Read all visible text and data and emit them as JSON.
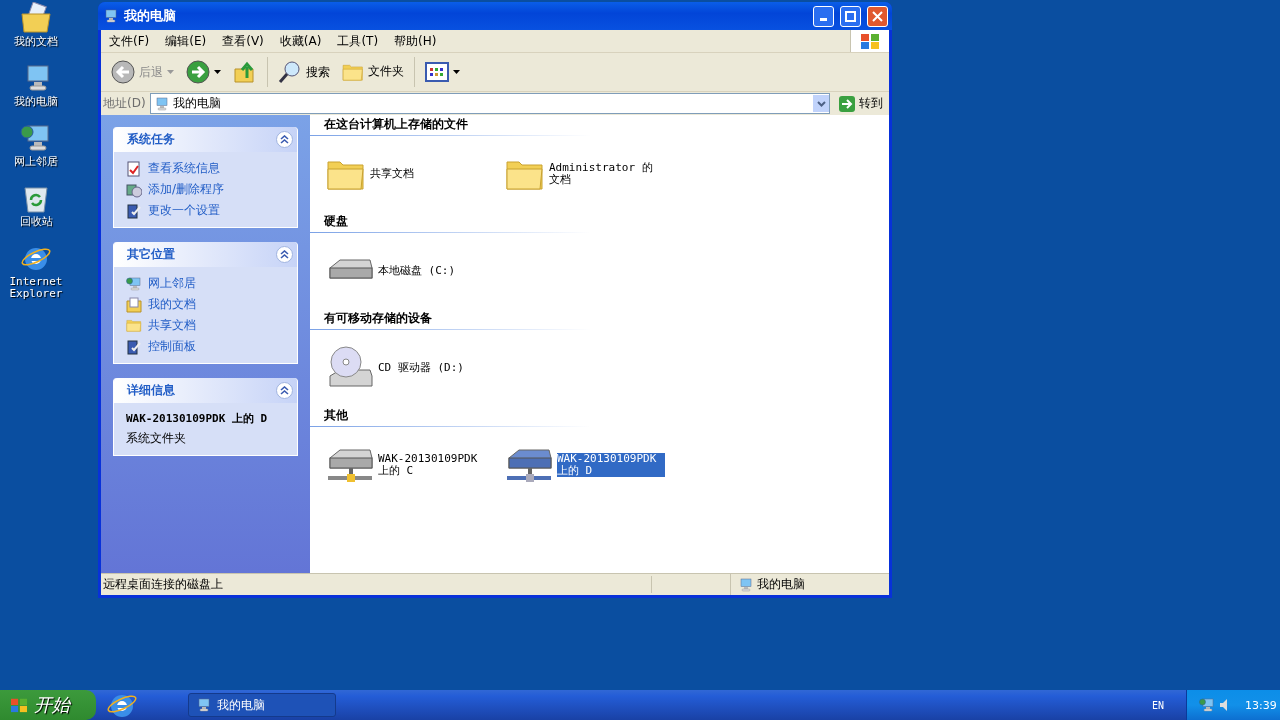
{
  "desktop": {
    "icons": [
      {
        "label": "我的文档",
        "kind": "documents"
      },
      {
        "label": "我的电脑",
        "kind": "computer"
      },
      {
        "label": "网上邻居",
        "kind": "network"
      },
      {
        "label": "回收站",
        "kind": "recycle"
      },
      {
        "label": "Internet Explorer",
        "kind": "browser"
      }
    ]
  },
  "window": {
    "title": "我的电脑",
    "menu": [
      "文件(F)",
      "编辑(E)",
      "查看(V)",
      "收藏(A)",
      "工具(T)",
      "帮助(H)"
    ],
    "toolbar": {
      "back": {
        "label": "后退",
        "disabled": true
      },
      "search": "搜索",
      "folders": "文件夹"
    },
    "address": {
      "label": "地址(D)",
      "value": "我的电脑",
      "go": "转到"
    },
    "sidebar": {
      "panels": [
        {
          "title": "系统任务",
          "expanded": true,
          "items": [
            {
              "label": "查看系统信息",
              "kind": "info"
            },
            {
              "label": "添加/删除程序",
              "kind": "programs"
            },
            {
              "label": "更改一个设置",
              "kind": "settings"
            }
          ]
        },
        {
          "title": "其它位置",
          "expanded": true,
          "items": [
            {
              "label": "网上邻居",
              "kind": "network"
            },
            {
              "label": "我的文档",
              "kind": "documents"
            },
            {
              "label": "共享文档",
              "kind": "folder"
            },
            {
              "label": "控制面板",
              "kind": "settings"
            }
          ]
        },
        {
          "title": "详细信息",
          "expanded": true,
          "details": {
            "name": "WAK-20130109PDK 上的 D",
            "type": "系统文件夹"
          }
        }
      ]
    },
    "sections": [
      {
        "heading": "在这台计算机上存储的文件",
        "items": [
          {
            "label": "共享文档",
            "kind": "folder",
            "selected": false
          },
          {
            "label": "Administrator 的文档",
            "kind": "folder",
            "selected": false
          }
        ]
      },
      {
        "heading": "硬盘",
        "items": [
          {
            "label": "本地磁盘 (C:)",
            "kind": "disk",
            "selected": false
          }
        ]
      },
      {
        "heading": "有可移动存储的设备",
        "items": [
          {
            "label": "CD 驱动器 (D:)",
            "kind": "cd",
            "selected": false
          }
        ]
      },
      {
        "heading": "其他",
        "items": [
          {
            "label": "WAK-20130109PDK 上的 C",
            "kind": "netdisk",
            "selected": false
          },
          {
            "label": "WAK-20130109PDK 上的 D",
            "kind": "netdisk",
            "selected": true
          }
        ]
      }
    ],
    "status_bar": {
      "text": "远程桌面连接的磁盘上",
      "location": "我的电脑"
    }
  },
  "taskbar": {
    "start": "开始",
    "task": "我的电脑",
    "language": "EN",
    "clock": "13:39"
  }
}
